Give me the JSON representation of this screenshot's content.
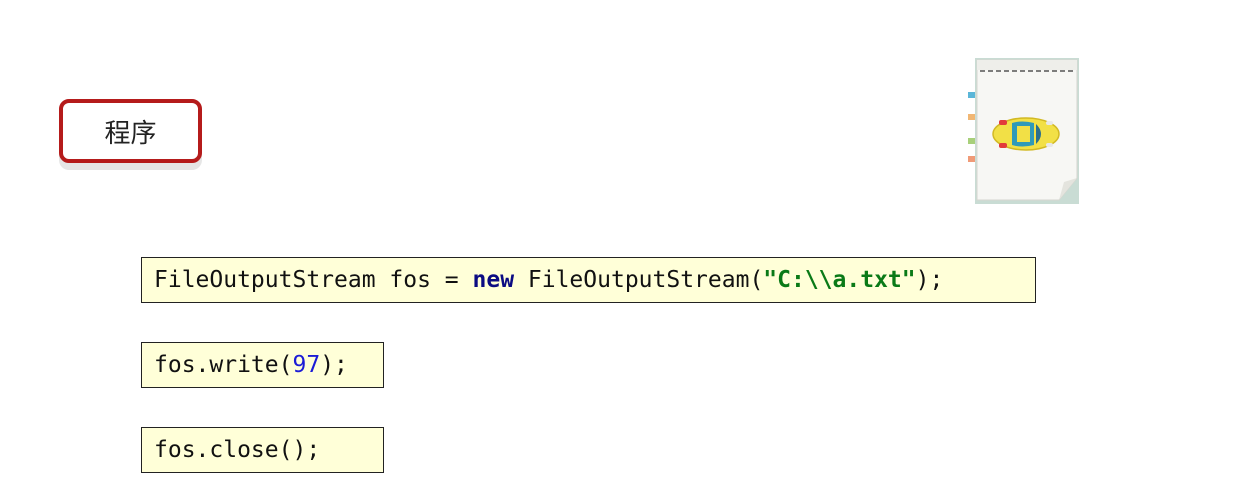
{
  "label": {
    "text": "程序"
  },
  "notebook": {
    "icon": "notebook-with-car-icon"
  },
  "code": {
    "line1": {
      "prefix": "FileOutputStream fos = ",
      "keyword": "new",
      "middle": " FileOutputStream(",
      "string": "\"C:\\\\a.txt\"",
      "suffix": ");"
    },
    "line2": {
      "prefix": "fos.write(",
      "number": "97",
      "suffix": ");"
    },
    "line3": {
      "text": "fos.close();"
    }
  },
  "colors": {
    "label_border": "#b51b1b",
    "code_background": "#ffffd8",
    "keyword": "#0b0b82",
    "string": "#0a7a17",
    "number": "#1c1cd6"
  }
}
